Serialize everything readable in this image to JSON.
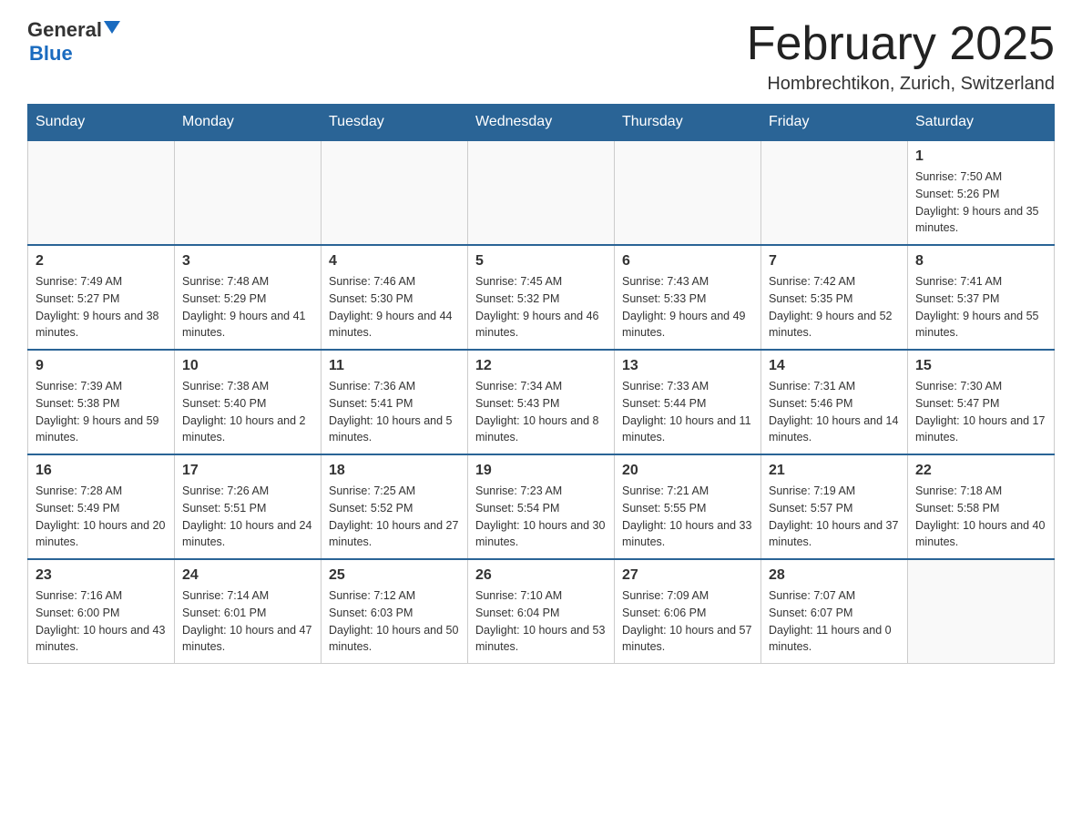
{
  "logo": {
    "text_general": "General",
    "text_blue": "Blue"
  },
  "title": "February 2025",
  "location": "Hombrechtikon, Zurich, Switzerland",
  "days_of_week": [
    "Sunday",
    "Monday",
    "Tuesday",
    "Wednesday",
    "Thursday",
    "Friday",
    "Saturday"
  ],
  "weeks": [
    [
      {
        "day": "",
        "info": ""
      },
      {
        "day": "",
        "info": ""
      },
      {
        "day": "",
        "info": ""
      },
      {
        "day": "",
        "info": ""
      },
      {
        "day": "",
        "info": ""
      },
      {
        "day": "",
        "info": ""
      },
      {
        "day": "1",
        "info": "Sunrise: 7:50 AM\nSunset: 5:26 PM\nDaylight: 9 hours and 35 minutes."
      }
    ],
    [
      {
        "day": "2",
        "info": "Sunrise: 7:49 AM\nSunset: 5:27 PM\nDaylight: 9 hours and 38 minutes."
      },
      {
        "day": "3",
        "info": "Sunrise: 7:48 AM\nSunset: 5:29 PM\nDaylight: 9 hours and 41 minutes."
      },
      {
        "day": "4",
        "info": "Sunrise: 7:46 AM\nSunset: 5:30 PM\nDaylight: 9 hours and 44 minutes."
      },
      {
        "day": "5",
        "info": "Sunrise: 7:45 AM\nSunset: 5:32 PM\nDaylight: 9 hours and 46 minutes."
      },
      {
        "day": "6",
        "info": "Sunrise: 7:43 AM\nSunset: 5:33 PM\nDaylight: 9 hours and 49 minutes."
      },
      {
        "day": "7",
        "info": "Sunrise: 7:42 AM\nSunset: 5:35 PM\nDaylight: 9 hours and 52 minutes."
      },
      {
        "day": "8",
        "info": "Sunrise: 7:41 AM\nSunset: 5:37 PM\nDaylight: 9 hours and 55 minutes."
      }
    ],
    [
      {
        "day": "9",
        "info": "Sunrise: 7:39 AM\nSunset: 5:38 PM\nDaylight: 9 hours and 59 minutes."
      },
      {
        "day": "10",
        "info": "Sunrise: 7:38 AM\nSunset: 5:40 PM\nDaylight: 10 hours and 2 minutes."
      },
      {
        "day": "11",
        "info": "Sunrise: 7:36 AM\nSunset: 5:41 PM\nDaylight: 10 hours and 5 minutes."
      },
      {
        "day": "12",
        "info": "Sunrise: 7:34 AM\nSunset: 5:43 PM\nDaylight: 10 hours and 8 minutes."
      },
      {
        "day": "13",
        "info": "Sunrise: 7:33 AM\nSunset: 5:44 PM\nDaylight: 10 hours and 11 minutes."
      },
      {
        "day": "14",
        "info": "Sunrise: 7:31 AM\nSunset: 5:46 PM\nDaylight: 10 hours and 14 minutes."
      },
      {
        "day": "15",
        "info": "Sunrise: 7:30 AM\nSunset: 5:47 PM\nDaylight: 10 hours and 17 minutes."
      }
    ],
    [
      {
        "day": "16",
        "info": "Sunrise: 7:28 AM\nSunset: 5:49 PM\nDaylight: 10 hours and 20 minutes."
      },
      {
        "day": "17",
        "info": "Sunrise: 7:26 AM\nSunset: 5:51 PM\nDaylight: 10 hours and 24 minutes."
      },
      {
        "day": "18",
        "info": "Sunrise: 7:25 AM\nSunset: 5:52 PM\nDaylight: 10 hours and 27 minutes."
      },
      {
        "day": "19",
        "info": "Sunrise: 7:23 AM\nSunset: 5:54 PM\nDaylight: 10 hours and 30 minutes."
      },
      {
        "day": "20",
        "info": "Sunrise: 7:21 AM\nSunset: 5:55 PM\nDaylight: 10 hours and 33 minutes."
      },
      {
        "day": "21",
        "info": "Sunrise: 7:19 AM\nSunset: 5:57 PM\nDaylight: 10 hours and 37 minutes."
      },
      {
        "day": "22",
        "info": "Sunrise: 7:18 AM\nSunset: 5:58 PM\nDaylight: 10 hours and 40 minutes."
      }
    ],
    [
      {
        "day": "23",
        "info": "Sunrise: 7:16 AM\nSunset: 6:00 PM\nDaylight: 10 hours and 43 minutes."
      },
      {
        "day": "24",
        "info": "Sunrise: 7:14 AM\nSunset: 6:01 PM\nDaylight: 10 hours and 47 minutes."
      },
      {
        "day": "25",
        "info": "Sunrise: 7:12 AM\nSunset: 6:03 PM\nDaylight: 10 hours and 50 minutes."
      },
      {
        "day": "26",
        "info": "Sunrise: 7:10 AM\nSunset: 6:04 PM\nDaylight: 10 hours and 53 minutes."
      },
      {
        "day": "27",
        "info": "Sunrise: 7:09 AM\nSunset: 6:06 PM\nDaylight: 10 hours and 57 minutes."
      },
      {
        "day": "28",
        "info": "Sunrise: 7:07 AM\nSunset: 6:07 PM\nDaylight: 11 hours and 0 minutes."
      },
      {
        "day": "",
        "info": ""
      }
    ]
  ]
}
